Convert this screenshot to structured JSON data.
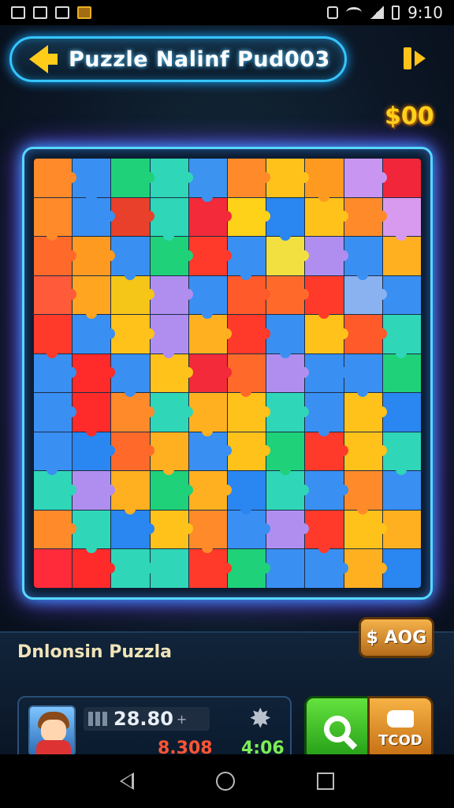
{
  "status_bar": {
    "time": "9:10"
  },
  "header": {
    "title": "Puzzle Nalinf Pud003"
  },
  "coins": "$00",
  "board": {
    "rows": 11,
    "cols": 10,
    "colors": [
      "#ff8a2a",
      "#3a8ff2",
      "#1fd27a",
      "#2fd6b8",
      "#3c93f0",
      "#ff8a2a",
      "#ffc21a",
      "#ff9a20",
      "#c896f0",
      "#f2263a",
      "#ff8a2a",
      "#3a8ff2",
      "#e8402a",
      "#2fd6b8",
      "#f22a3a",
      "#ffd21a",
      "#2a86f0",
      "#ffc21a",
      "#ff8a2a",
      "#d89aee",
      "#ff6a2a",
      "#ff9a20",
      "#3a8ff2",
      "#1fd27a",
      "#ff3a2a",
      "#3a8ff2",
      "#f2e040",
      "#b08ef0",
      "#3a8ff2",
      "#ffb020",
      "#ff5a3a",
      "#ffa520",
      "#f5c518",
      "#b08ef0",
      "#3a8ff2",
      "#ff5a2a",
      "#ff6a2a",
      "#ff3a2a",
      "#8ab2f0",
      "#3a8ff2",
      "#ff3a2a",
      "#3a8ff2",
      "#ffc21a",
      "#b08ef0",
      "#ffb020",
      "#ff3a2a",
      "#3a8ff2",
      "#ffc21a",
      "#ff5a2a",
      "#2fd6b8",
      "#3a8ff2",
      "#ff2a2a",
      "#3a8ff2",
      "#ffc21a",
      "#f22a3a",
      "#ff6a2a",
      "#b08ef0",
      "#3a8ff2",
      "#3a8ff2",
      "#1fd27a",
      "#3a8ff2",
      "#ff2a2a",
      "#ff8a2a",
      "#2fd6b8",
      "#ffb020",
      "#ffc21a",
      "#2fd6b8",
      "#3a8ff2",
      "#ffc21a",
      "#2a86f0",
      "#3a8ff2",
      "#2a86f0",
      "#ff6a2a",
      "#ffb020",
      "#3a8ff2",
      "#ffc21a",
      "#1fd27a",
      "#ff3a2a",
      "#ffc21a",
      "#2fd6b8",
      "#2fd6b8",
      "#b08ef0",
      "#ffb020",
      "#1fd27a",
      "#ffb020",
      "#2a86f0",
      "#2fd6b8",
      "#3a8ff2",
      "#ff8a2a",
      "#3a8ff2",
      "#ff8a2a",
      "#2fd6b8",
      "#2a86f0",
      "#ffc21a",
      "#ff8a2a",
      "#3a8ff2",
      "#b08ef0",
      "#ff3a2a",
      "#ffc21a",
      "#ffb020",
      "#ff2a3a",
      "#ff2a2a",
      "#2fd6b8",
      "#2fd6b8",
      "#ff3a2a",
      "#1fd27a",
      "#3a8ff2",
      "#3a8ff2",
      "#ffb020",
      "#2a86f0"
    ]
  },
  "bottom": {
    "puzzle_name": "Dnlonsin Puzzla",
    "price_button": "$ AOG",
    "score": "28.80",
    "red_value": "8.308",
    "green_value": "4:06",
    "action_label": "TCOD"
  },
  "icons": {
    "back": "back-arrow-icon",
    "exit": "exit-icon",
    "hint": "magnifier-icon",
    "action": "hand-icon",
    "star": "star-icon"
  }
}
